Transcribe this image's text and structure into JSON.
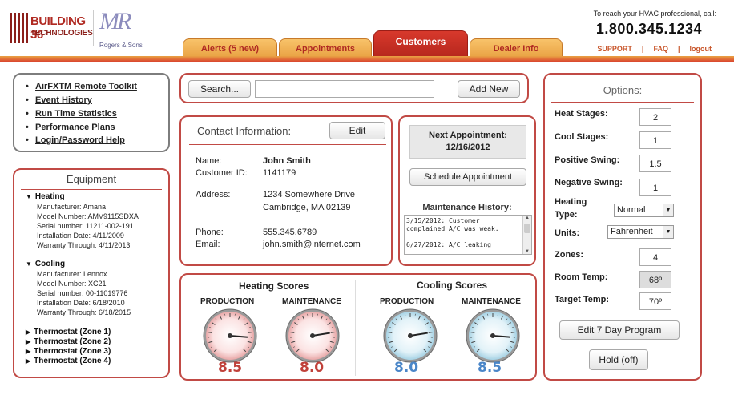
{
  "brand": {
    "logo_line1": "BUILDING 36",
    "logo_line2": "TECHNOLOGIES",
    "partner_monogram": "MR",
    "partner_name": "Rogers & Sons"
  },
  "tabs": [
    {
      "label": "Alerts (5 new)",
      "active": false
    },
    {
      "label": "Appointments",
      "active": false
    },
    {
      "label": "Customers",
      "active": true
    },
    {
      "label": "Dealer Info",
      "active": false
    }
  ],
  "contact_bar": {
    "note": "To reach your HVAC professional, call:",
    "phone": "1.800.345.1234",
    "links": [
      "SUPPORT",
      "FAQ",
      "logout"
    ],
    "separator": "|"
  },
  "tools": {
    "items": [
      "AirFXTM Remote Toolkit",
      "Event History",
      "Run Time Statistics",
      "Performance Plans",
      "Login/Password Help"
    ]
  },
  "search": {
    "button": "Search...",
    "value": "",
    "add_new": "Add New"
  },
  "equipment": {
    "title": "Equipment",
    "heating": {
      "name": "Heating",
      "lines": [
        "Manufacturer: Amana",
        "Model Number: AMV9115SDXA",
        "Serial number: 11211-002-191",
        "Installation Date: 4/11/2009",
        "Warranty Through: 4/11/2013"
      ]
    },
    "cooling": {
      "name": "Cooling",
      "lines": [
        "Manufacturer: Lennox",
        "Model Number: XC21",
        "Serial number: 00-11019776",
        "Installation Date: 6/18/2010",
        "Warranty Through: 6/18/2015"
      ]
    },
    "thermostats": [
      "Thermostat (Zone 1)",
      "Thermostat (Zone 2)",
      "Thermostat (Zone 3)",
      "Thermostat (Zone 4)"
    ]
  },
  "contact": {
    "title": "Contact Information:",
    "edit": "Edit",
    "name_label": "Name:",
    "name": "John Smith",
    "id_label": "Customer ID:",
    "id": "1141179",
    "address_label": "Address:",
    "address1": "1234 Somewhere Drive",
    "address2": "Cambridge, MA 02139",
    "phone_label": "Phone:",
    "phone": "555.345.6789",
    "email_label": "Email:",
    "email": "john.smith@internet.com"
  },
  "appointment": {
    "title": "Next Appointment:",
    "date": "12/16/2012",
    "schedule_button": "Schedule Appointment",
    "history_title": "Maintenance History:",
    "history_text": "3/15/2012: Customer complained A/C was weak.\n\n6/27/2012: A/C leaking"
  },
  "options": {
    "title": "Options:",
    "heat_stages_label": "Heat Stages:",
    "heat_stages": "2",
    "cool_stages_label": "Cool Stages:",
    "cool_stages": "1",
    "pos_swing_label": "Positive Swing:",
    "pos_swing": "1.5",
    "neg_swing_label": "Negative Swing:",
    "neg_swing": "1",
    "heating_type_label1": "Heating",
    "heating_type_label2": "Type:",
    "heating_type": "Normal",
    "units_label": "Units:",
    "units": "Fahrenheit",
    "zones_label": "Zones:",
    "zones": "4",
    "room_temp_label": "Room Temp:",
    "room_temp": "68º",
    "target_temp_label": "Target Temp:",
    "target_temp": "70º",
    "program_button": "Edit 7 Day Program",
    "hold_button": "Hold (off)"
  },
  "scores": {
    "heating_title": "Heating Scores",
    "cooling_title": "Cooling Scores",
    "gauges": [
      {
        "label": "PRODUCTION",
        "score": "8.5",
        "value": 8.5,
        "theme": "red"
      },
      {
        "label": "MAINTENANCE",
        "score": "8.0",
        "value": 8.0,
        "theme": "red"
      },
      {
        "label": "PRODUCTION",
        "score": "8.0",
        "value": 8.0,
        "theme": "blue"
      },
      {
        "label": "MAINTENANCE",
        "score": "8.5",
        "value": 8.5,
        "theme": "blue"
      }
    ],
    "scale_max": 10
  },
  "colors": {
    "brand_red": "#c14a45",
    "score_red": "#c0413a",
    "score_blue": "#4a86c8",
    "tab_orange": "#e9a243"
  }
}
